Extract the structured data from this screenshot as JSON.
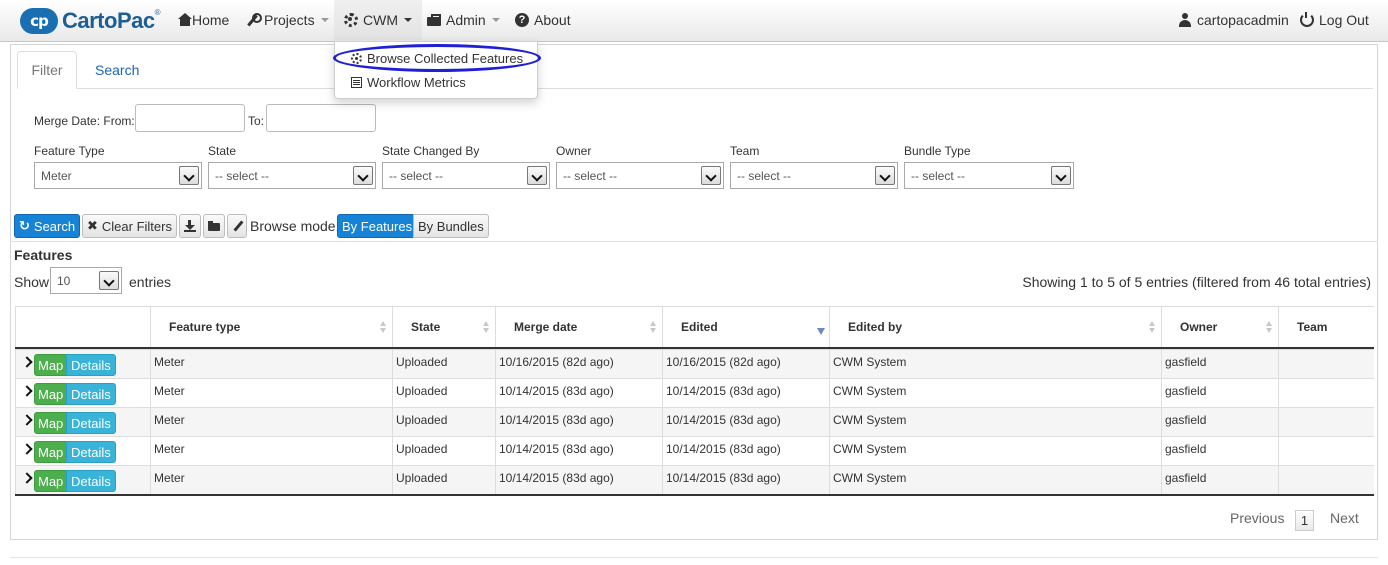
{
  "brand": {
    "logo_mark": "cp",
    "name": "CartoPac",
    "mark": "®"
  },
  "nav": {
    "home": "Home",
    "projects": "Projects",
    "cwm": "CWM",
    "admin": "Admin",
    "about": "About",
    "user": "cartopacadmin",
    "logout": "Log Out"
  },
  "cwm_menu": {
    "items": [
      "Browse Collected Features",
      "Workflow Metrics"
    ],
    "highlighted": "Browse Collected Features"
  },
  "tabs": {
    "filter": "Filter",
    "search": "Search",
    "active": "Filter"
  },
  "filters": {
    "merge_date_from": "Merge Date: From:",
    "merge_date_to": "To:",
    "from_value": "",
    "to_value": "",
    "fields": [
      {
        "label": "Feature Type",
        "value": "Meter"
      },
      {
        "label": "State",
        "value": "-- select --"
      },
      {
        "label": "State Changed By",
        "value": "-- select --"
      },
      {
        "label": "Owner",
        "value": "-- select --"
      },
      {
        "label": "Team",
        "value": "-- select --"
      },
      {
        "label": "Bundle Type",
        "value": "-- select --"
      }
    ]
  },
  "toolbar": {
    "search": "Search",
    "clear_filters": "Clear Filters",
    "browse_mode_label": "Browse mode:",
    "by_features": "By Features",
    "by_bundles": "By Bundles",
    "active_mode": "By Features"
  },
  "features": {
    "title": "Features",
    "show": "Show",
    "page_size": "10",
    "entries": "entries",
    "info": "Showing 1 to 5 of 5 entries (filtered from 46 total entries)",
    "columns": [
      "Feature type",
      "State",
      "Merge date",
      "Edited",
      "Edited by",
      "Owner",
      "Team"
    ],
    "sorted_column": "Edited",
    "sort_direction": "desc",
    "row_buttons": {
      "map": "Map",
      "details": "Details"
    },
    "rows": [
      [
        "Meter",
        "Uploaded",
        "10/16/2015 (82d ago)",
        "10/16/2015 (82d ago)",
        "CWM System",
        "gasfield",
        ""
      ],
      [
        "Meter",
        "Uploaded",
        "10/14/2015 (83d ago)",
        "10/14/2015 (83d ago)",
        "CWM System",
        "gasfield",
        ""
      ],
      [
        "Meter",
        "Uploaded",
        "10/14/2015 (83d ago)",
        "10/14/2015 (83d ago)",
        "CWM System",
        "gasfield",
        ""
      ],
      [
        "Meter",
        "Uploaded",
        "10/14/2015 (83d ago)",
        "10/14/2015 (83d ago)",
        "CWM System",
        "gasfield",
        ""
      ],
      [
        "Meter",
        "Uploaded",
        "10/14/2015 (83d ago)",
        "10/14/2015 (83d ago)",
        "CWM System",
        "gasfield",
        ""
      ]
    ]
  },
  "pagination": {
    "previous": "Previous",
    "current": "1",
    "next": "Next"
  },
  "colors": {
    "primary": "#1683d6",
    "brand": "#1a6fb3",
    "map_button": "#4cae4c",
    "details_button": "#39b3d7",
    "highlight": "#1f1fd6"
  }
}
